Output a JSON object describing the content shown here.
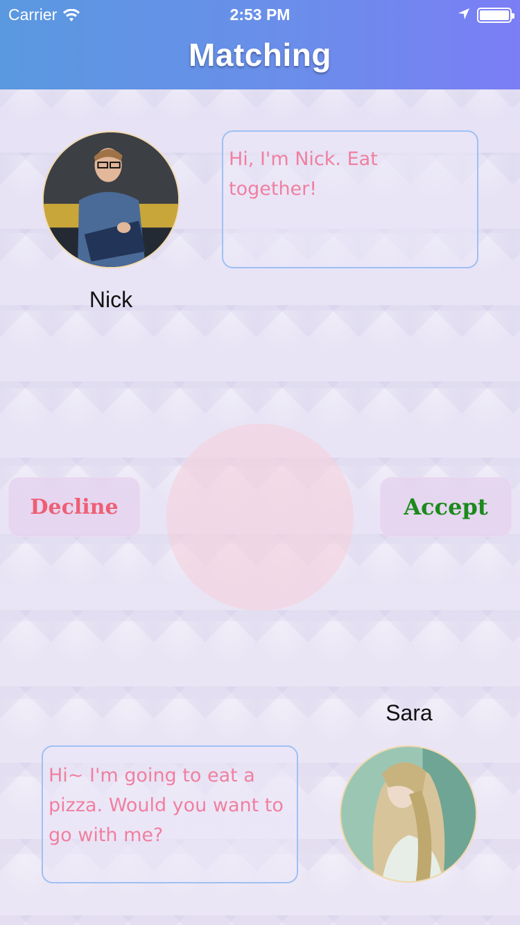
{
  "status_bar": {
    "carrier": "Carrier",
    "time": "2:53 PM",
    "wifi_icon": "wifi-icon",
    "location_icon": "location-arrow-icon",
    "battery_icon": "battery-full-icon"
  },
  "header": {
    "title": "Matching",
    "gradient": [
      "#5a98e0",
      "#7b7ef5"
    ]
  },
  "profiles": {
    "nick": {
      "name": "Nick",
      "message": "Hi, I'm Nick. Eat together!"
    },
    "sara": {
      "name": "Sara",
      "message": "Hi~ I'm going to eat a pizza. Would you want to go with me?"
    }
  },
  "actions": {
    "decline_label": "Decline",
    "accept_label": "Accept"
  },
  "colors": {
    "message_text": "#f07fa0",
    "message_border": "#9ec0f3",
    "decline_text": "#ee5f74",
    "accept_text": "#1b8a1b",
    "match_circle": "#f5d0dc"
  }
}
